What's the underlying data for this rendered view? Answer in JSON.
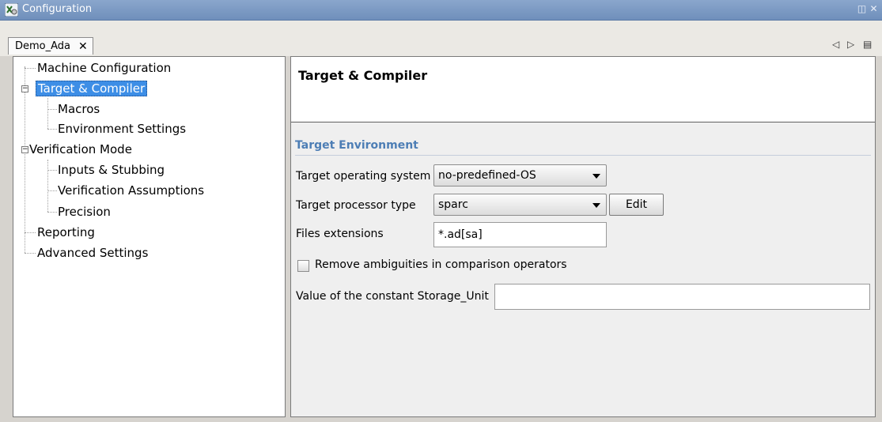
{
  "window": {
    "title": "Configuration",
    "restore_icon": "restore-icon",
    "close_icon": "close-icon"
  },
  "tabs": [
    {
      "label": "Demo_Ada",
      "close": "✕"
    }
  ],
  "tab_nav": {
    "prev": "◁",
    "next": "▷",
    "menu": "▤"
  },
  "tree": {
    "items": [
      {
        "label": "Machine Configuration"
      },
      {
        "label": "Target & Compiler",
        "selected": true
      },
      {
        "label": "Macros"
      },
      {
        "label": "Environment Settings"
      },
      {
        "label": "Verification Mode"
      },
      {
        "label": "Inputs & Stubbing"
      },
      {
        "label": "Verification Assumptions"
      },
      {
        "label": "Precision"
      },
      {
        "label": "Reporting"
      },
      {
        "label": "Advanced Settings"
      }
    ]
  },
  "content": {
    "header": "Target & Compiler",
    "section_title": "Target Environment",
    "os_label": "Target operating system",
    "os_value": "no-predefined-OS",
    "proc_label": "Target processor type",
    "proc_value": "sparc",
    "edit_label": "Edit",
    "ext_label": "Files extensions",
    "ext_value": "*.ad[sa]",
    "ambiguity_label": "Remove ambiguities in comparison operators",
    "ambiguity_checked": false,
    "storage_label": "Value of the constant Storage_Unit",
    "storage_value": ""
  },
  "colors": {
    "titlebar": "#7a98c2",
    "selection": "#3d8ee6",
    "section_title": "#4d7eb5"
  }
}
